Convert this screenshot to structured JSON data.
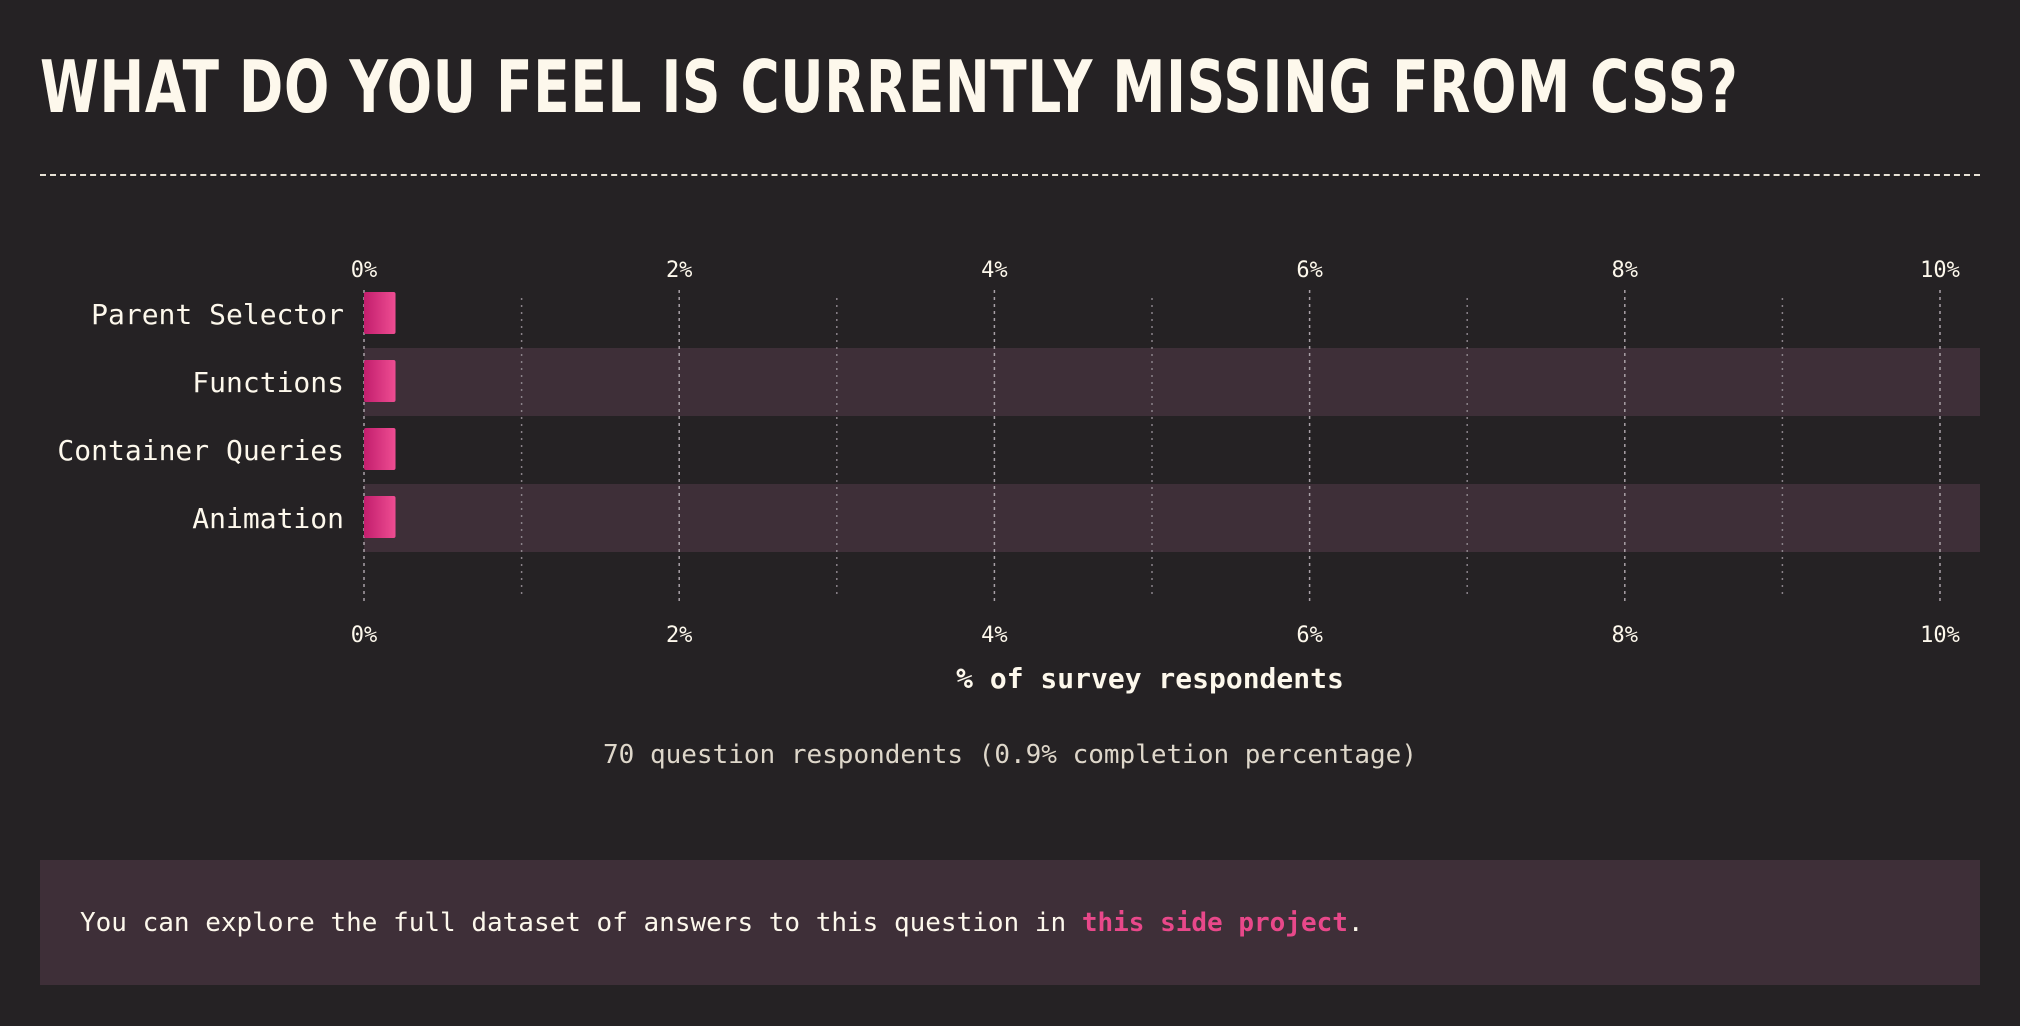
{
  "page": {
    "title": "What do you feel is currently missing from CSS?",
    "respondents_note": "70 question respondents (0.9% completion percentage)",
    "callout": {
      "prefix": "You can explore the full dataset of answers to this question in ",
      "link_label": "this side project",
      "suffix": "."
    }
  },
  "colors": {
    "background": "#252224",
    "band": "#3e2f38",
    "bar_start": "#c21e6d",
    "bar_end": "#ee4d92",
    "text": "#fdf8ec",
    "link": "#e8488a"
  },
  "chart_data": {
    "type": "bar",
    "orientation": "horizontal",
    "categories": [
      "Parent Selector",
      "Functions",
      "Container Queries",
      "Animation"
    ],
    "values": [
      0.2,
      0.2,
      0.2,
      0.2
    ],
    "xlim": [
      0,
      10
    ],
    "xticks": [
      0,
      2,
      4,
      6,
      8,
      10
    ],
    "tick_labels": [
      "0%",
      "2%",
      "4%",
      "6%",
      "8%",
      "10%"
    ],
    "minor_ticks": [
      1,
      3,
      5,
      7,
      9
    ],
    "xlabel": "% of survey respondents",
    "tick_labels_top_and_bottom": true,
    "alternating_row_bands": true
  }
}
